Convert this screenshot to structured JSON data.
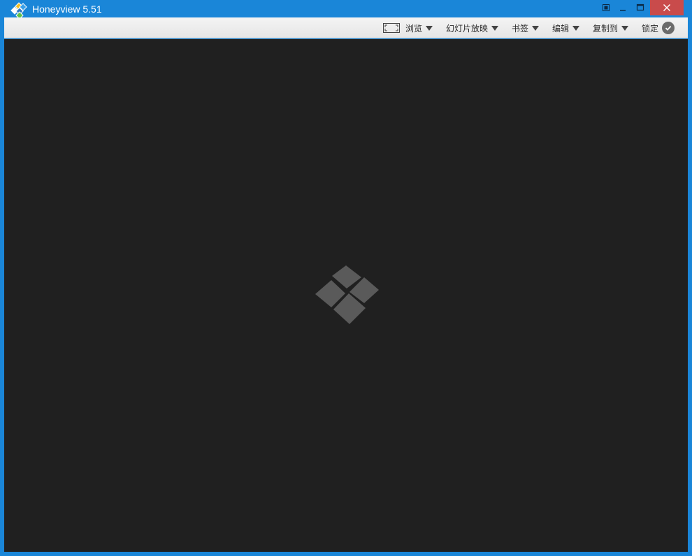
{
  "window": {
    "title": "Honeyview 5.51",
    "app_icon": "honeyview-logo-icon",
    "controls": {
      "fullscreen": "fullscreen-icon",
      "minimize": "minimize-icon",
      "maximize": "maximize-icon",
      "close": "close-icon"
    }
  },
  "toolbar": {
    "browse_label": "浏览",
    "slideshow_label": "幻灯片放映",
    "bookmark_label": "书签",
    "edit_label": "编辑",
    "copyto_label": "复制到",
    "lock_label": "锁定"
  },
  "viewer": {
    "placeholder_icon": "honeyview-placeholder-logo-icon"
  },
  "colors": {
    "titlebar": "#1a86d8",
    "close_button": "#c94b4b",
    "viewer_background": "#202020",
    "placeholder_logo": "#5a5a5a"
  }
}
